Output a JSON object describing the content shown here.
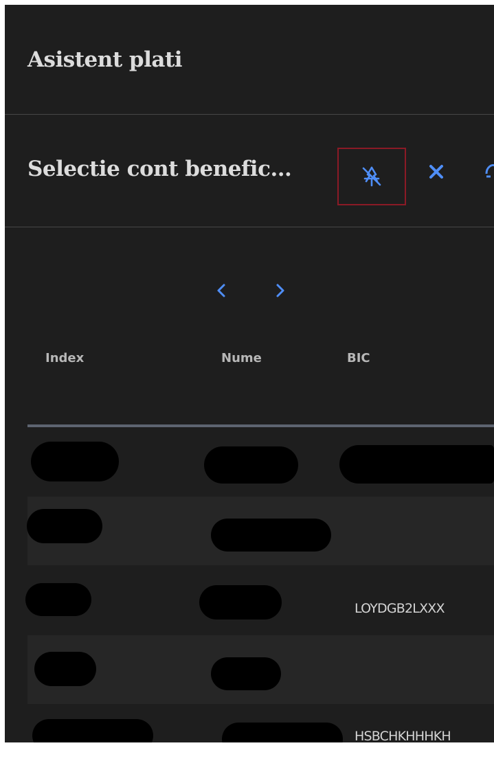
{
  "app": {
    "title": "Asistent plati"
  },
  "dialog": {
    "title": "Selectie cont benefic...",
    "icons": {
      "pin": "unpin-icon",
      "close": "close-icon",
      "extra": "partial-icon"
    },
    "accent_color": "#4f8ef7",
    "pin_outline_color": "#8b1a26"
  },
  "pager": {
    "prev": "‹",
    "next": "›"
  },
  "table": {
    "columns": [
      "Index",
      "Nume",
      "BIC"
    ],
    "rows": [
      {
        "index": "",
        "nume": "",
        "bic": ""
      },
      {
        "index": "",
        "nume": "",
        "bic": ""
      },
      {
        "index": "",
        "nume": "",
        "bic": "LOYDGB2LXXX"
      },
      {
        "index": "",
        "nume": "",
        "bic": ""
      },
      {
        "index": "",
        "nume": "",
        "bic": "HSBCHKHHHKH"
      }
    ]
  }
}
